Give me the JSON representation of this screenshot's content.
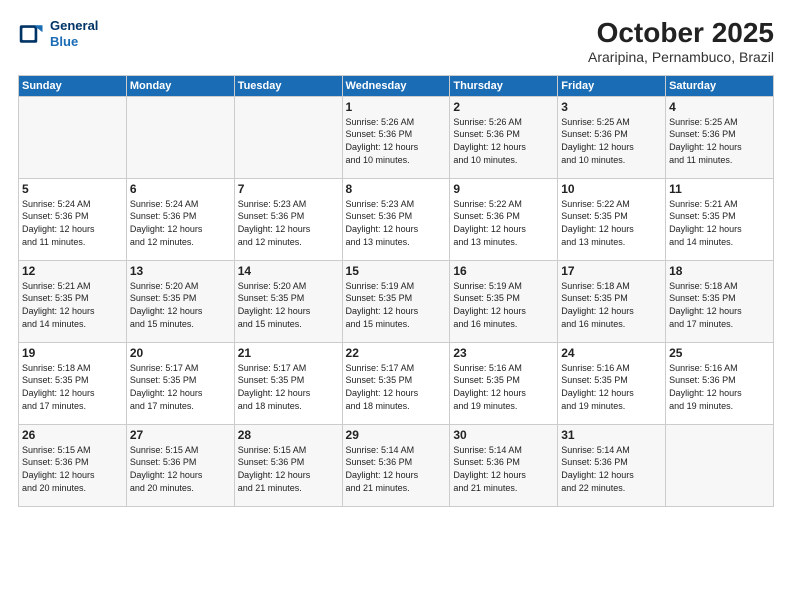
{
  "header": {
    "logo_line1": "General",
    "logo_line2": "Blue",
    "month": "October 2025",
    "location": "Araripina, Pernambuco, Brazil"
  },
  "days_of_week": [
    "Sunday",
    "Monday",
    "Tuesday",
    "Wednesday",
    "Thursday",
    "Friday",
    "Saturday"
  ],
  "weeks": [
    [
      {
        "day": "",
        "info": ""
      },
      {
        "day": "",
        "info": ""
      },
      {
        "day": "",
        "info": ""
      },
      {
        "day": "1",
        "info": "Sunrise: 5:26 AM\nSunset: 5:36 PM\nDaylight: 12 hours\nand 10 minutes."
      },
      {
        "day": "2",
        "info": "Sunrise: 5:26 AM\nSunset: 5:36 PM\nDaylight: 12 hours\nand 10 minutes."
      },
      {
        "day": "3",
        "info": "Sunrise: 5:25 AM\nSunset: 5:36 PM\nDaylight: 12 hours\nand 10 minutes."
      },
      {
        "day": "4",
        "info": "Sunrise: 5:25 AM\nSunset: 5:36 PM\nDaylight: 12 hours\nand 11 minutes."
      }
    ],
    [
      {
        "day": "5",
        "info": "Sunrise: 5:24 AM\nSunset: 5:36 PM\nDaylight: 12 hours\nand 11 minutes."
      },
      {
        "day": "6",
        "info": "Sunrise: 5:24 AM\nSunset: 5:36 PM\nDaylight: 12 hours\nand 12 minutes."
      },
      {
        "day": "7",
        "info": "Sunrise: 5:23 AM\nSunset: 5:36 PM\nDaylight: 12 hours\nand 12 minutes."
      },
      {
        "day": "8",
        "info": "Sunrise: 5:23 AM\nSunset: 5:36 PM\nDaylight: 12 hours\nand 13 minutes."
      },
      {
        "day": "9",
        "info": "Sunrise: 5:22 AM\nSunset: 5:36 PM\nDaylight: 12 hours\nand 13 minutes."
      },
      {
        "day": "10",
        "info": "Sunrise: 5:22 AM\nSunset: 5:35 PM\nDaylight: 12 hours\nand 13 minutes."
      },
      {
        "day": "11",
        "info": "Sunrise: 5:21 AM\nSunset: 5:35 PM\nDaylight: 12 hours\nand 14 minutes."
      }
    ],
    [
      {
        "day": "12",
        "info": "Sunrise: 5:21 AM\nSunset: 5:35 PM\nDaylight: 12 hours\nand 14 minutes."
      },
      {
        "day": "13",
        "info": "Sunrise: 5:20 AM\nSunset: 5:35 PM\nDaylight: 12 hours\nand 15 minutes."
      },
      {
        "day": "14",
        "info": "Sunrise: 5:20 AM\nSunset: 5:35 PM\nDaylight: 12 hours\nand 15 minutes."
      },
      {
        "day": "15",
        "info": "Sunrise: 5:19 AM\nSunset: 5:35 PM\nDaylight: 12 hours\nand 15 minutes."
      },
      {
        "day": "16",
        "info": "Sunrise: 5:19 AM\nSunset: 5:35 PM\nDaylight: 12 hours\nand 16 minutes."
      },
      {
        "day": "17",
        "info": "Sunrise: 5:18 AM\nSunset: 5:35 PM\nDaylight: 12 hours\nand 16 minutes."
      },
      {
        "day": "18",
        "info": "Sunrise: 5:18 AM\nSunset: 5:35 PM\nDaylight: 12 hours\nand 17 minutes."
      }
    ],
    [
      {
        "day": "19",
        "info": "Sunrise: 5:18 AM\nSunset: 5:35 PM\nDaylight: 12 hours\nand 17 minutes."
      },
      {
        "day": "20",
        "info": "Sunrise: 5:17 AM\nSunset: 5:35 PM\nDaylight: 12 hours\nand 17 minutes."
      },
      {
        "day": "21",
        "info": "Sunrise: 5:17 AM\nSunset: 5:35 PM\nDaylight: 12 hours\nand 18 minutes."
      },
      {
        "day": "22",
        "info": "Sunrise: 5:17 AM\nSunset: 5:35 PM\nDaylight: 12 hours\nand 18 minutes."
      },
      {
        "day": "23",
        "info": "Sunrise: 5:16 AM\nSunset: 5:35 PM\nDaylight: 12 hours\nand 19 minutes."
      },
      {
        "day": "24",
        "info": "Sunrise: 5:16 AM\nSunset: 5:35 PM\nDaylight: 12 hours\nand 19 minutes."
      },
      {
        "day": "25",
        "info": "Sunrise: 5:16 AM\nSunset: 5:36 PM\nDaylight: 12 hours\nand 19 minutes."
      }
    ],
    [
      {
        "day": "26",
        "info": "Sunrise: 5:15 AM\nSunset: 5:36 PM\nDaylight: 12 hours\nand 20 minutes."
      },
      {
        "day": "27",
        "info": "Sunrise: 5:15 AM\nSunset: 5:36 PM\nDaylight: 12 hours\nand 20 minutes."
      },
      {
        "day": "28",
        "info": "Sunrise: 5:15 AM\nSunset: 5:36 PM\nDaylight: 12 hours\nand 21 minutes."
      },
      {
        "day": "29",
        "info": "Sunrise: 5:14 AM\nSunset: 5:36 PM\nDaylight: 12 hours\nand 21 minutes."
      },
      {
        "day": "30",
        "info": "Sunrise: 5:14 AM\nSunset: 5:36 PM\nDaylight: 12 hours\nand 21 minutes."
      },
      {
        "day": "31",
        "info": "Sunrise: 5:14 AM\nSunset: 5:36 PM\nDaylight: 12 hours\nand 22 minutes."
      },
      {
        "day": "",
        "info": ""
      }
    ]
  ]
}
